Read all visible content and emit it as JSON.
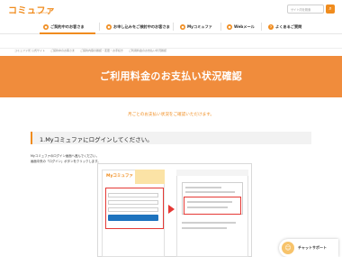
{
  "header": {
    "logo": "コミュファ",
    "logo_sub": "commufa",
    "search_placeholder": "サイト内を検索"
  },
  "nav": {
    "items": [
      {
        "label": "ご契約中のお客さま",
        "icon": "user-icon"
      },
      {
        "label": "お申し込みをご検討中のお客さま",
        "icon": "cart-icon"
      },
      {
        "label": "Myコミュファ",
        "icon": "person-icon"
      },
      {
        "label": "Webメール",
        "icon": "mail-icon"
      },
      {
        "label": "よくあるご質問",
        "icon": "question-icon"
      }
    ]
  },
  "subnav": {
    "items": [
      "ご契約内容の確認・変更・お手続き",
      "「Myコミュファ」",
      "各種接続・設定方法",
      "ご利用中の皆さまだけの特典・キャンペーン",
      "よくあるご質問",
      "障害情報",
      "メンテナンス情報"
    ]
  },
  "breadcrumb": [
    "コミュファ光 公式サイト",
    "ご契約中のお客さま",
    "ご契約内容の確認・変更・お手続き",
    "ご利用料金のお支払い状況確認"
  ],
  "hero": {
    "title": "ご利用料金のお支払い状況確認"
  },
  "lead": "月ごとのお支払い状況をご確認いただけます。",
  "section": {
    "title": "1.Myコミュファにログインしてください。",
    "line1": "Myコミュファのログイン画面へ進んでください。",
    "line2": "画面中央の「ログイン」ボタンをクリックします。"
  },
  "chat": {
    "label": "チャットサポート"
  },
  "colors": {
    "accent": "#f08c1e",
    "hero": "#f08c3c",
    "highlight": "#e53935"
  }
}
